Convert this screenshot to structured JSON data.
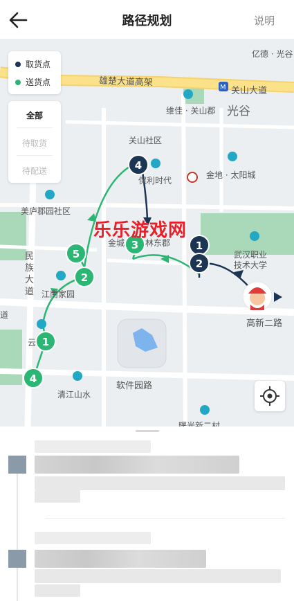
{
  "header": {
    "title": "路径规划",
    "help_label": "说明"
  },
  "legend": {
    "pickup_label": "取货点",
    "delivery_label": "送货点",
    "pickup_color": "#1b3553",
    "delivery_color": "#2bb673"
  },
  "filter": {
    "all": "全部",
    "to_pickup": "待取货",
    "to_deliver": "待配送"
  },
  "map": {
    "labels": {
      "yixiong_road": "雄楚大道高架",
      "guanshan_avenue": "关山大道",
      "yide_guanggu": "亿德 · 光谷",
      "guanggu": "光谷",
      "weijia_guanshan": "维佳 · 关山郡",
      "guanshan_community": "关山社区",
      "baoli_shidai": "保利时代",
      "jindi_taiyang": "金地 · 太阳城",
      "meilu_community": "美庐郡园社区",
      "minzu_road_1": "民",
      "minzu_road_2": "族",
      "minzu_road_3": "大",
      "minzu_road_4": "道",
      "jiangnan_home": "江南家园",
      "jinxiu_partial": "金城",
      "linxiu_partial": "林东郡",
      "wuhan_vocational_1": "武汉职业",
      "wuhan_vocational_2": "技术大学",
      "gaoxin_road": "高新二路",
      "dao_partial": "道",
      "yun_partial": "云",
      "ruanjian_park": "软件园路",
      "qingjiang_shanshui": "清江山水",
      "bottom_partial": "曙光新二村",
      "watermark": "乐乐游戏网"
    },
    "markers": [
      {
        "id": "pickup-4",
        "type": "pickup",
        "label": "4"
      },
      {
        "id": "pickup-1",
        "type": "pickup",
        "label": "1"
      },
      {
        "id": "pickup-2",
        "type": "pickup",
        "label": "2"
      },
      {
        "id": "delivery-3",
        "type": "delivery",
        "label": "3"
      },
      {
        "id": "delivery-5",
        "type": "delivery",
        "label": "5"
      },
      {
        "id": "delivery-2",
        "type": "delivery",
        "label": "2"
      },
      {
        "id": "delivery-1",
        "type": "delivery",
        "label": "1"
      },
      {
        "id": "delivery-4",
        "type": "delivery",
        "label": "4"
      }
    ]
  }
}
